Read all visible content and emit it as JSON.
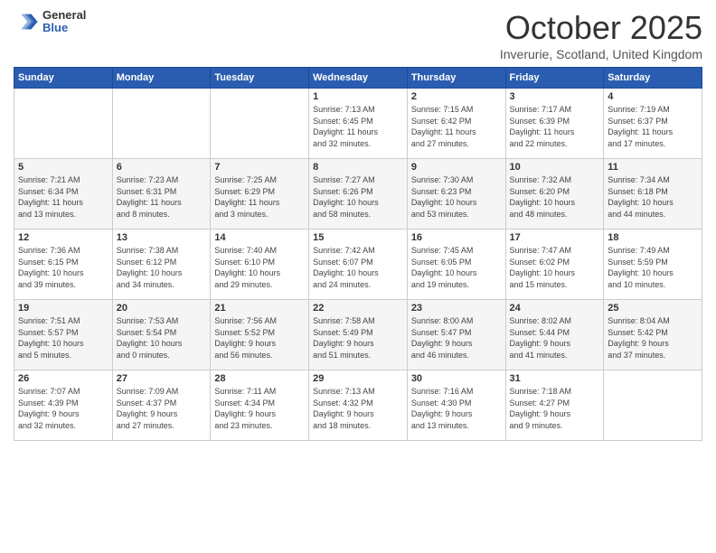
{
  "header": {
    "logo_general": "General",
    "logo_blue": "Blue",
    "title": "October 2025",
    "location": "Inverurie, Scotland, United Kingdom"
  },
  "days_of_week": [
    "Sunday",
    "Monday",
    "Tuesday",
    "Wednesday",
    "Thursday",
    "Friday",
    "Saturday"
  ],
  "weeks": [
    [
      {
        "day": "",
        "info": ""
      },
      {
        "day": "",
        "info": ""
      },
      {
        "day": "",
        "info": ""
      },
      {
        "day": "1",
        "info": "Sunrise: 7:13 AM\nSunset: 6:45 PM\nDaylight: 11 hours\nand 32 minutes."
      },
      {
        "day": "2",
        "info": "Sunrise: 7:15 AM\nSunset: 6:42 PM\nDaylight: 11 hours\nand 27 minutes."
      },
      {
        "day": "3",
        "info": "Sunrise: 7:17 AM\nSunset: 6:39 PM\nDaylight: 11 hours\nand 22 minutes."
      },
      {
        "day": "4",
        "info": "Sunrise: 7:19 AM\nSunset: 6:37 PM\nDaylight: 11 hours\nand 17 minutes."
      }
    ],
    [
      {
        "day": "5",
        "info": "Sunrise: 7:21 AM\nSunset: 6:34 PM\nDaylight: 11 hours\nand 13 minutes."
      },
      {
        "day": "6",
        "info": "Sunrise: 7:23 AM\nSunset: 6:31 PM\nDaylight: 11 hours\nand 8 minutes."
      },
      {
        "day": "7",
        "info": "Sunrise: 7:25 AM\nSunset: 6:29 PM\nDaylight: 11 hours\nand 3 minutes."
      },
      {
        "day": "8",
        "info": "Sunrise: 7:27 AM\nSunset: 6:26 PM\nDaylight: 10 hours\nand 58 minutes."
      },
      {
        "day": "9",
        "info": "Sunrise: 7:30 AM\nSunset: 6:23 PM\nDaylight: 10 hours\nand 53 minutes."
      },
      {
        "day": "10",
        "info": "Sunrise: 7:32 AM\nSunset: 6:20 PM\nDaylight: 10 hours\nand 48 minutes."
      },
      {
        "day": "11",
        "info": "Sunrise: 7:34 AM\nSunset: 6:18 PM\nDaylight: 10 hours\nand 44 minutes."
      }
    ],
    [
      {
        "day": "12",
        "info": "Sunrise: 7:36 AM\nSunset: 6:15 PM\nDaylight: 10 hours\nand 39 minutes."
      },
      {
        "day": "13",
        "info": "Sunrise: 7:38 AM\nSunset: 6:12 PM\nDaylight: 10 hours\nand 34 minutes."
      },
      {
        "day": "14",
        "info": "Sunrise: 7:40 AM\nSunset: 6:10 PM\nDaylight: 10 hours\nand 29 minutes."
      },
      {
        "day": "15",
        "info": "Sunrise: 7:42 AM\nSunset: 6:07 PM\nDaylight: 10 hours\nand 24 minutes."
      },
      {
        "day": "16",
        "info": "Sunrise: 7:45 AM\nSunset: 6:05 PM\nDaylight: 10 hours\nand 19 minutes."
      },
      {
        "day": "17",
        "info": "Sunrise: 7:47 AM\nSunset: 6:02 PM\nDaylight: 10 hours\nand 15 minutes."
      },
      {
        "day": "18",
        "info": "Sunrise: 7:49 AM\nSunset: 5:59 PM\nDaylight: 10 hours\nand 10 minutes."
      }
    ],
    [
      {
        "day": "19",
        "info": "Sunrise: 7:51 AM\nSunset: 5:57 PM\nDaylight: 10 hours\nand 5 minutes."
      },
      {
        "day": "20",
        "info": "Sunrise: 7:53 AM\nSunset: 5:54 PM\nDaylight: 10 hours\nand 0 minutes."
      },
      {
        "day": "21",
        "info": "Sunrise: 7:56 AM\nSunset: 5:52 PM\nDaylight: 9 hours\nand 56 minutes."
      },
      {
        "day": "22",
        "info": "Sunrise: 7:58 AM\nSunset: 5:49 PM\nDaylight: 9 hours\nand 51 minutes."
      },
      {
        "day": "23",
        "info": "Sunrise: 8:00 AM\nSunset: 5:47 PM\nDaylight: 9 hours\nand 46 minutes."
      },
      {
        "day": "24",
        "info": "Sunrise: 8:02 AM\nSunset: 5:44 PM\nDaylight: 9 hours\nand 41 minutes."
      },
      {
        "day": "25",
        "info": "Sunrise: 8:04 AM\nSunset: 5:42 PM\nDaylight: 9 hours\nand 37 minutes."
      }
    ],
    [
      {
        "day": "26",
        "info": "Sunrise: 7:07 AM\nSunset: 4:39 PM\nDaylight: 9 hours\nand 32 minutes."
      },
      {
        "day": "27",
        "info": "Sunrise: 7:09 AM\nSunset: 4:37 PM\nDaylight: 9 hours\nand 27 minutes."
      },
      {
        "day": "28",
        "info": "Sunrise: 7:11 AM\nSunset: 4:34 PM\nDaylight: 9 hours\nand 23 minutes."
      },
      {
        "day": "29",
        "info": "Sunrise: 7:13 AM\nSunset: 4:32 PM\nDaylight: 9 hours\nand 18 minutes."
      },
      {
        "day": "30",
        "info": "Sunrise: 7:16 AM\nSunset: 4:30 PM\nDaylight: 9 hours\nand 13 minutes."
      },
      {
        "day": "31",
        "info": "Sunrise: 7:18 AM\nSunset: 4:27 PM\nDaylight: 9 hours\nand 9 minutes."
      },
      {
        "day": "",
        "info": ""
      }
    ]
  ]
}
